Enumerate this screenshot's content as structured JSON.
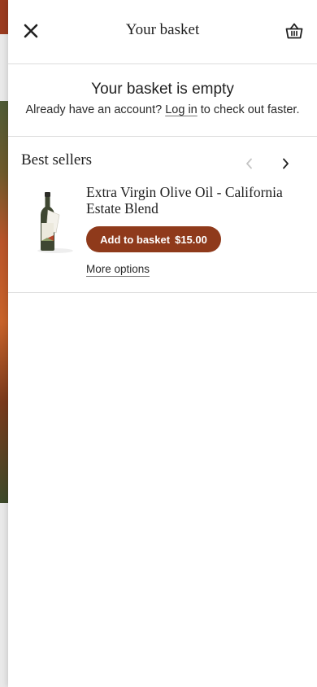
{
  "header": {
    "title": "Your basket"
  },
  "empty_state": {
    "title": "Your basket is empty",
    "prefix": "Already have an account?",
    "login_link": "Log in",
    "suffix": "to check out faster."
  },
  "best_sellers": {
    "title": "Best sellers",
    "products": [
      {
        "name": "Extra Virgin Olive Oil - California Estate Blend",
        "add_label": "Add to basket",
        "price": "$15.00",
        "more_options": "More options"
      }
    ]
  },
  "colors": {
    "accent": "#8f3a1b",
    "divider": "#dcdcdc",
    "text": "#1f1f1f"
  },
  "icons": {
    "close": "close-icon",
    "basket": "basket-icon",
    "prev": "chevron-left-icon",
    "next": "chevron-right-icon"
  }
}
